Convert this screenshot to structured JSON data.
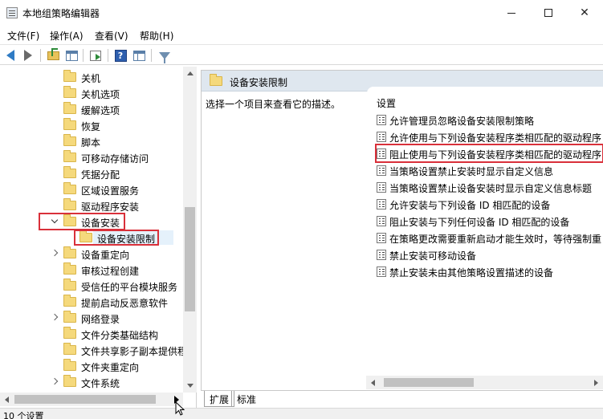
{
  "window": {
    "title": "本地组策略编辑器",
    "controls": {
      "minimize": "—",
      "maximize": "☐",
      "close": "✕"
    }
  },
  "menu": {
    "items": [
      "文件(F)",
      "操作(A)",
      "查看(V)",
      "帮助(H)"
    ]
  },
  "toolbar": {
    "icons": [
      "back-arrow-icon",
      "forward-arrow-icon",
      "up-folder-icon",
      "show-hide-tree-icon",
      "export-list-icon",
      "help-icon",
      "properties-pane-icon",
      "filter-icon"
    ],
    "help_glyph": "?"
  },
  "tree": {
    "items": [
      {
        "label": "关机",
        "expander": "none",
        "level": 1
      },
      {
        "label": "关机选项",
        "expander": "none",
        "level": 1
      },
      {
        "label": "缓解选项",
        "expander": "none",
        "level": 1
      },
      {
        "label": "恢复",
        "expander": "none",
        "level": 1
      },
      {
        "label": "脚本",
        "expander": "none",
        "level": 1
      },
      {
        "label": "可移动存储访问",
        "expander": "none",
        "level": 1
      },
      {
        "label": "凭据分配",
        "expander": "none",
        "level": 1
      },
      {
        "label": "区域设置服务",
        "expander": "none",
        "level": 1
      },
      {
        "label": "驱动程序安装",
        "expander": "none",
        "level": 1
      },
      {
        "label": "设备安装",
        "expander": "expanded",
        "level": 1,
        "highlighted": true
      },
      {
        "label": "设备安装限制",
        "expander": "none",
        "level": 2,
        "selected": true,
        "highlighted": true
      },
      {
        "label": "设备重定向",
        "expander": "collapsed",
        "level": 1
      },
      {
        "label": "审核过程创建",
        "expander": "none",
        "level": 1
      },
      {
        "label": "受信任的平台模块服务",
        "expander": "none",
        "level": 1
      },
      {
        "label": "提前启动反恶意软件",
        "expander": "none",
        "level": 1
      },
      {
        "label": "网络登录",
        "expander": "collapsed",
        "level": 1
      },
      {
        "label": "文件分类基础结构",
        "expander": "none",
        "level": 1
      },
      {
        "label": "文件共享影子副本提供程",
        "expander": "none",
        "level": 1
      },
      {
        "label": "文件夹重定向",
        "expander": "none",
        "level": 1
      },
      {
        "label": "文件系统",
        "expander": "collapsed",
        "level": 1
      }
    ]
  },
  "details": {
    "title": "设备安装限制",
    "description": "选择一个项目来查看它的描述。",
    "column_header": "设置",
    "policies": [
      {
        "label": "允许管理员忽略设备安装限制策略"
      },
      {
        "label": "允许使用与下列设备安装程序类相匹配的驱动程序"
      },
      {
        "label": "阻止使用与下列设备安装程序类相匹配的驱动程序",
        "highlighted": true
      },
      {
        "label": "当策略设置禁止安装时显示自定义信息"
      },
      {
        "label": "当策略设置禁止设备安装时显示自定义信息标题"
      },
      {
        "label": "允许安装与下列设备 ID 相匹配的设备"
      },
      {
        "label": "阻止安装与下列任何设备 ID 相匹配的设备"
      },
      {
        "label": "在策略更改需要重新启动才能生效时，等待强制重"
      },
      {
        "label": "禁止安装可移动设备"
      },
      {
        "label": "禁止安装未由其他策略设置描述的设备"
      }
    ]
  },
  "tabs": [
    {
      "label": "扩展",
      "active": true
    },
    {
      "label": "标准",
      "active": false
    }
  ],
  "status": {
    "text": "10 个设置"
  },
  "colors": {
    "highlight_border": "#d9303a",
    "selection_bg": "#e5f1fb",
    "header_bg": "#dfe7ef",
    "folder": "#f5d97c"
  }
}
